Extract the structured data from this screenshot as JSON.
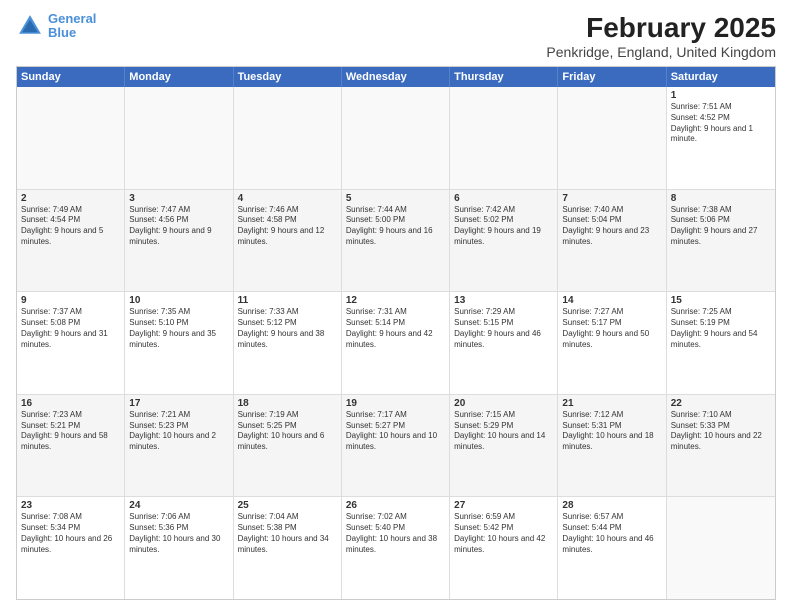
{
  "header": {
    "logo_line1": "General",
    "logo_line2": "Blue",
    "title": "February 2025",
    "subtitle": "Penkridge, England, United Kingdom"
  },
  "weekdays": [
    "Sunday",
    "Monday",
    "Tuesday",
    "Wednesday",
    "Thursday",
    "Friday",
    "Saturday"
  ],
  "rows": [
    [
      {
        "day": "",
        "info": ""
      },
      {
        "day": "",
        "info": ""
      },
      {
        "day": "",
        "info": ""
      },
      {
        "day": "",
        "info": ""
      },
      {
        "day": "",
        "info": ""
      },
      {
        "day": "",
        "info": ""
      },
      {
        "day": "1",
        "info": "Sunrise: 7:51 AM\nSunset: 4:52 PM\nDaylight: 9 hours and 1 minute."
      }
    ],
    [
      {
        "day": "2",
        "info": "Sunrise: 7:49 AM\nSunset: 4:54 PM\nDaylight: 9 hours and 5 minutes."
      },
      {
        "day": "3",
        "info": "Sunrise: 7:47 AM\nSunset: 4:56 PM\nDaylight: 9 hours and 9 minutes."
      },
      {
        "day": "4",
        "info": "Sunrise: 7:46 AM\nSunset: 4:58 PM\nDaylight: 9 hours and 12 minutes."
      },
      {
        "day": "5",
        "info": "Sunrise: 7:44 AM\nSunset: 5:00 PM\nDaylight: 9 hours and 16 minutes."
      },
      {
        "day": "6",
        "info": "Sunrise: 7:42 AM\nSunset: 5:02 PM\nDaylight: 9 hours and 19 minutes."
      },
      {
        "day": "7",
        "info": "Sunrise: 7:40 AM\nSunset: 5:04 PM\nDaylight: 9 hours and 23 minutes."
      },
      {
        "day": "8",
        "info": "Sunrise: 7:38 AM\nSunset: 5:06 PM\nDaylight: 9 hours and 27 minutes."
      }
    ],
    [
      {
        "day": "9",
        "info": "Sunrise: 7:37 AM\nSunset: 5:08 PM\nDaylight: 9 hours and 31 minutes."
      },
      {
        "day": "10",
        "info": "Sunrise: 7:35 AM\nSunset: 5:10 PM\nDaylight: 9 hours and 35 minutes."
      },
      {
        "day": "11",
        "info": "Sunrise: 7:33 AM\nSunset: 5:12 PM\nDaylight: 9 hours and 38 minutes."
      },
      {
        "day": "12",
        "info": "Sunrise: 7:31 AM\nSunset: 5:14 PM\nDaylight: 9 hours and 42 minutes."
      },
      {
        "day": "13",
        "info": "Sunrise: 7:29 AM\nSunset: 5:15 PM\nDaylight: 9 hours and 46 minutes."
      },
      {
        "day": "14",
        "info": "Sunrise: 7:27 AM\nSunset: 5:17 PM\nDaylight: 9 hours and 50 minutes."
      },
      {
        "day": "15",
        "info": "Sunrise: 7:25 AM\nSunset: 5:19 PM\nDaylight: 9 hours and 54 minutes."
      }
    ],
    [
      {
        "day": "16",
        "info": "Sunrise: 7:23 AM\nSunset: 5:21 PM\nDaylight: 9 hours and 58 minutes."
      },
      {
        "day": "17",
        "info": "Sunrise: 7:21 AM\nSunset: 5:23 PM\nDaylight: 10 hours and 2 minutes."
      },
      {
        "day": "18",
        "info": "Sunrise: 7:19 AM\nSunset: 5:25 PM\nDaylight: 10 hours and 6 minutes."
      },
      {
        "day": "19",
        "info": "Sunrise: 7:17 AM\nSunset: 5:27 PM\nDaylight: 10 hours and 10 minutes."
      },
      {
        "day": "20",
        "info": "Sunrise: 7:15 AM\nSunset: 5:29 PM\nDaylight: 10 hours and 14 minutes."
      },
      {
        "day": "21",
        "info": "Sunrise: 7:12 AM\nSunset: 5:31 PM\nDaylight: 10 hours and 18 minutes."
      },
      {
        "day": "22",
        "info": "Sunrise: 7:10 AM\nSunset: 5:33 PM\nDaylight: 10 hours and 22 minutes."
      }
    ],
    [
      {
        "day": "23",
        "info": "Sunrise: 7:08 AM\nSunset: 5:34 PM\nDaylight: 10 hours and 26 minutes."
      },
      {
        "day": "24",
        "info": "Sunrise: 7:06 AM\nSunset: 5:36 PM\nDaylight: 10 hours and 30 minutes."
      },
      {
        "day": "25",
        "info": "Sunrise: 7:04 AM\nSunset: 5:38 PM\nDaylight: 10 hours and 34 minutes."
      },
      {
        "day": "26",
        "info": "Sunrise: 7:02 AM\nSunset: 5:40 PM\nDaylight: 10 hours and 38 minutes."
      },
      {
        "day": "27",
        "info": "Sunrise: 6:59 AM\nSunset: 5:42 PM\nDaylight: 10 hours and 42 minutes."
      },
      {
        "day": "28",
        "info": "Sunrise: 6:57 AM\nSunset: 5:44 PM\nDaylight: 10 hours and 46 minutes."
      },
      {
        "day": "",
        "info": ""
      }
    ]
  ]
}
